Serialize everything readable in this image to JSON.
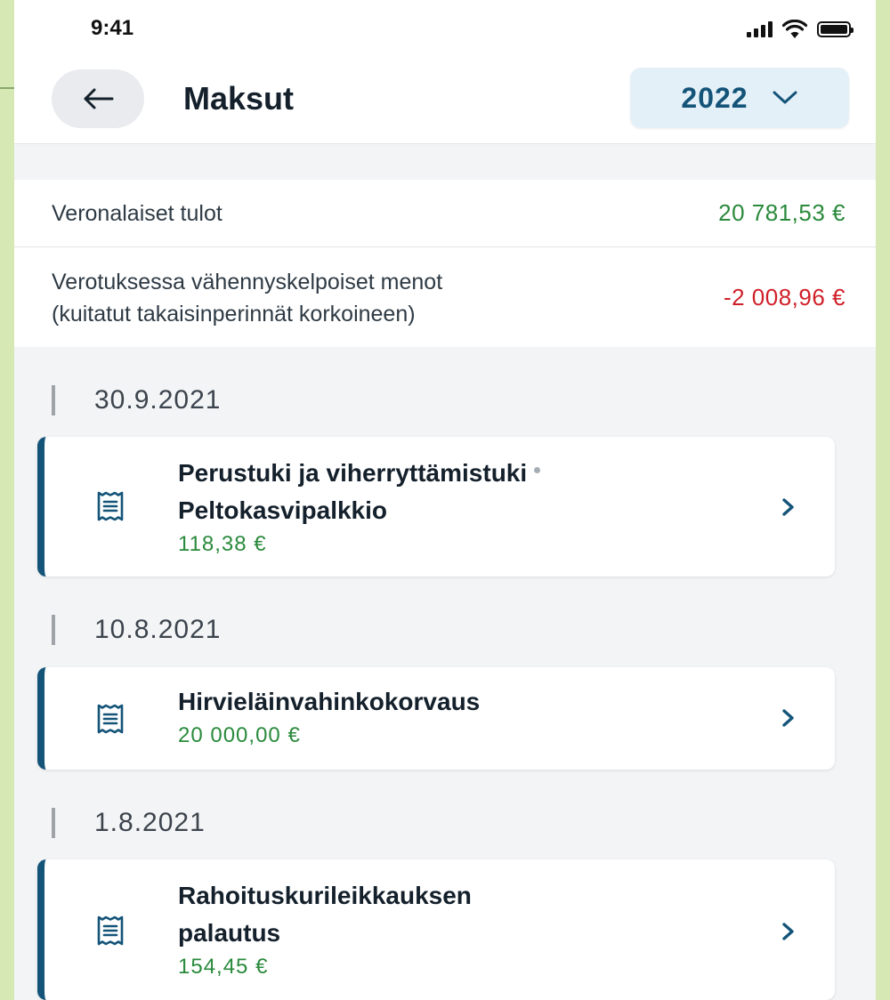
{
  "status_bar": {
    "time": "9:41"
  },
  "header": {
    "title": "Maksut",
    "year": "2022"
  },
  "summary": {
    "taxable_income_label": "Veronalaiset tulot",
    "taxable_income_value": "20 781,53 €",
    "deductible_label_line1": "Verotuksessa vähennyskelpoiset menot",
    "deductible_label_line2": "(kuitatut takaisinperinnät korkoineen)",
    "deductible_value": "-2 008,96 €"
  },
  "payments": [
    {
      "date": "30.9.2021",
      "title_line1": "Perustuki ja viherryttämistuki",
      "title_line2": "Peltokasvipalkkio",
      "amount": "118,38 €"
    },
    {
      "date": "10.8.2021",
      "title_line1": "Hirvieläinvahinkokorvaus",
      "amount": "20 000,00 €"
    },
    {
      "date": "1.8.2021",
      "title_line1": "Rahoituskurileikkauksen",
      "title_line2": "palautus",
      "amount": "154,45 €"
    }
  ],
  "colors": {
    "accent": "#145479",
    "positive": "#2a8a3c",
    "negative": "#d0202a",
    "page_background": "#d6e8b4"
  }
}
